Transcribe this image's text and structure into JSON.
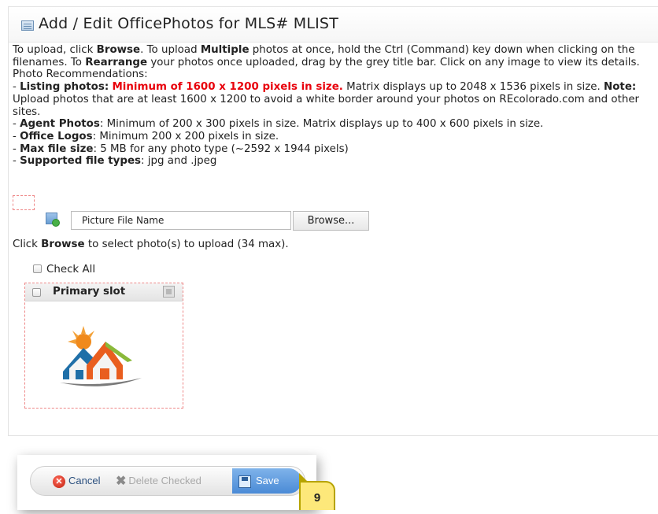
{
  "header": {
    "title": "Add / Edit OfficePhotos for MLS# MLIST",
    "icon": "table-icon"
  },
  "instructions": {
    "p1_a": "To upload, click ",
    "p1_browse": "Browse",
    "p1_b": ". To upload ",
    "p1_multiple": "Multiple",
    "p1_c": " photos at once, hold the Ctrl (Command) key down when clicking on the filenames. To ",
    "p1_rearrange": "Rearrange",
    "p1_d": " your photos once uploaded, drag by the grey title bar. Click on any image to view its details.",
    "recommendations": "Photo Recommendations:",
    "dash": "- ",
    "listing_label": "Listing photos:",
    "listing_red": "Minimum of 1600 x 1200 pixels in size.",
    "listing_rest": " Matrix displays up to 2048 x 1536 pixels in size. ",
    "note_label": "Note:",
    "note_text": " Upload photos that are at least 1600 x 1200 to avoid a white border around your photos on REcolorado.com and other sites.",
    "agent_label": "Agent Photos",
    "agent_text": ": Minimum of 200 x 300 pixels in size. Matrix displays up to 400 x 600 pixels in size.",
    "office_label": "Office Logos",
    "office_text": ": Minimum 200 x 200 pixels in size.",
    "max_label": "Max file size",
    "max_text": ": 5 MB for any photo type (~2592 x 1944 pixels)",
    "types_label": "Supported file types",
    "types_text": ": jpg and .jpeg"
  },
  "upload": {
    "filename_placeholder": "Picture File Name",
    "browse_label": "Browse...",
    "hint_a": "Click ",
    "hint_browse": "Browse",
    "hint_b": " to select photo(s) to upload (34 max)."
  },
  "check_all_label": "Check All",
  "slot": {
    "label": "Primary slot"
  },
  "toolbar": {
    "cancel_label": "Cancel",
    "delete_label": "Delete Checked",
    "save_label": "Save"
  },
  "callout": {
    "number": "9"
  },
  "colors": {
    "warning_red": "#e8000b",
    "save_blue": "#4a8ad6",
    "callout_yellow": "#fde87a"
  }
}
